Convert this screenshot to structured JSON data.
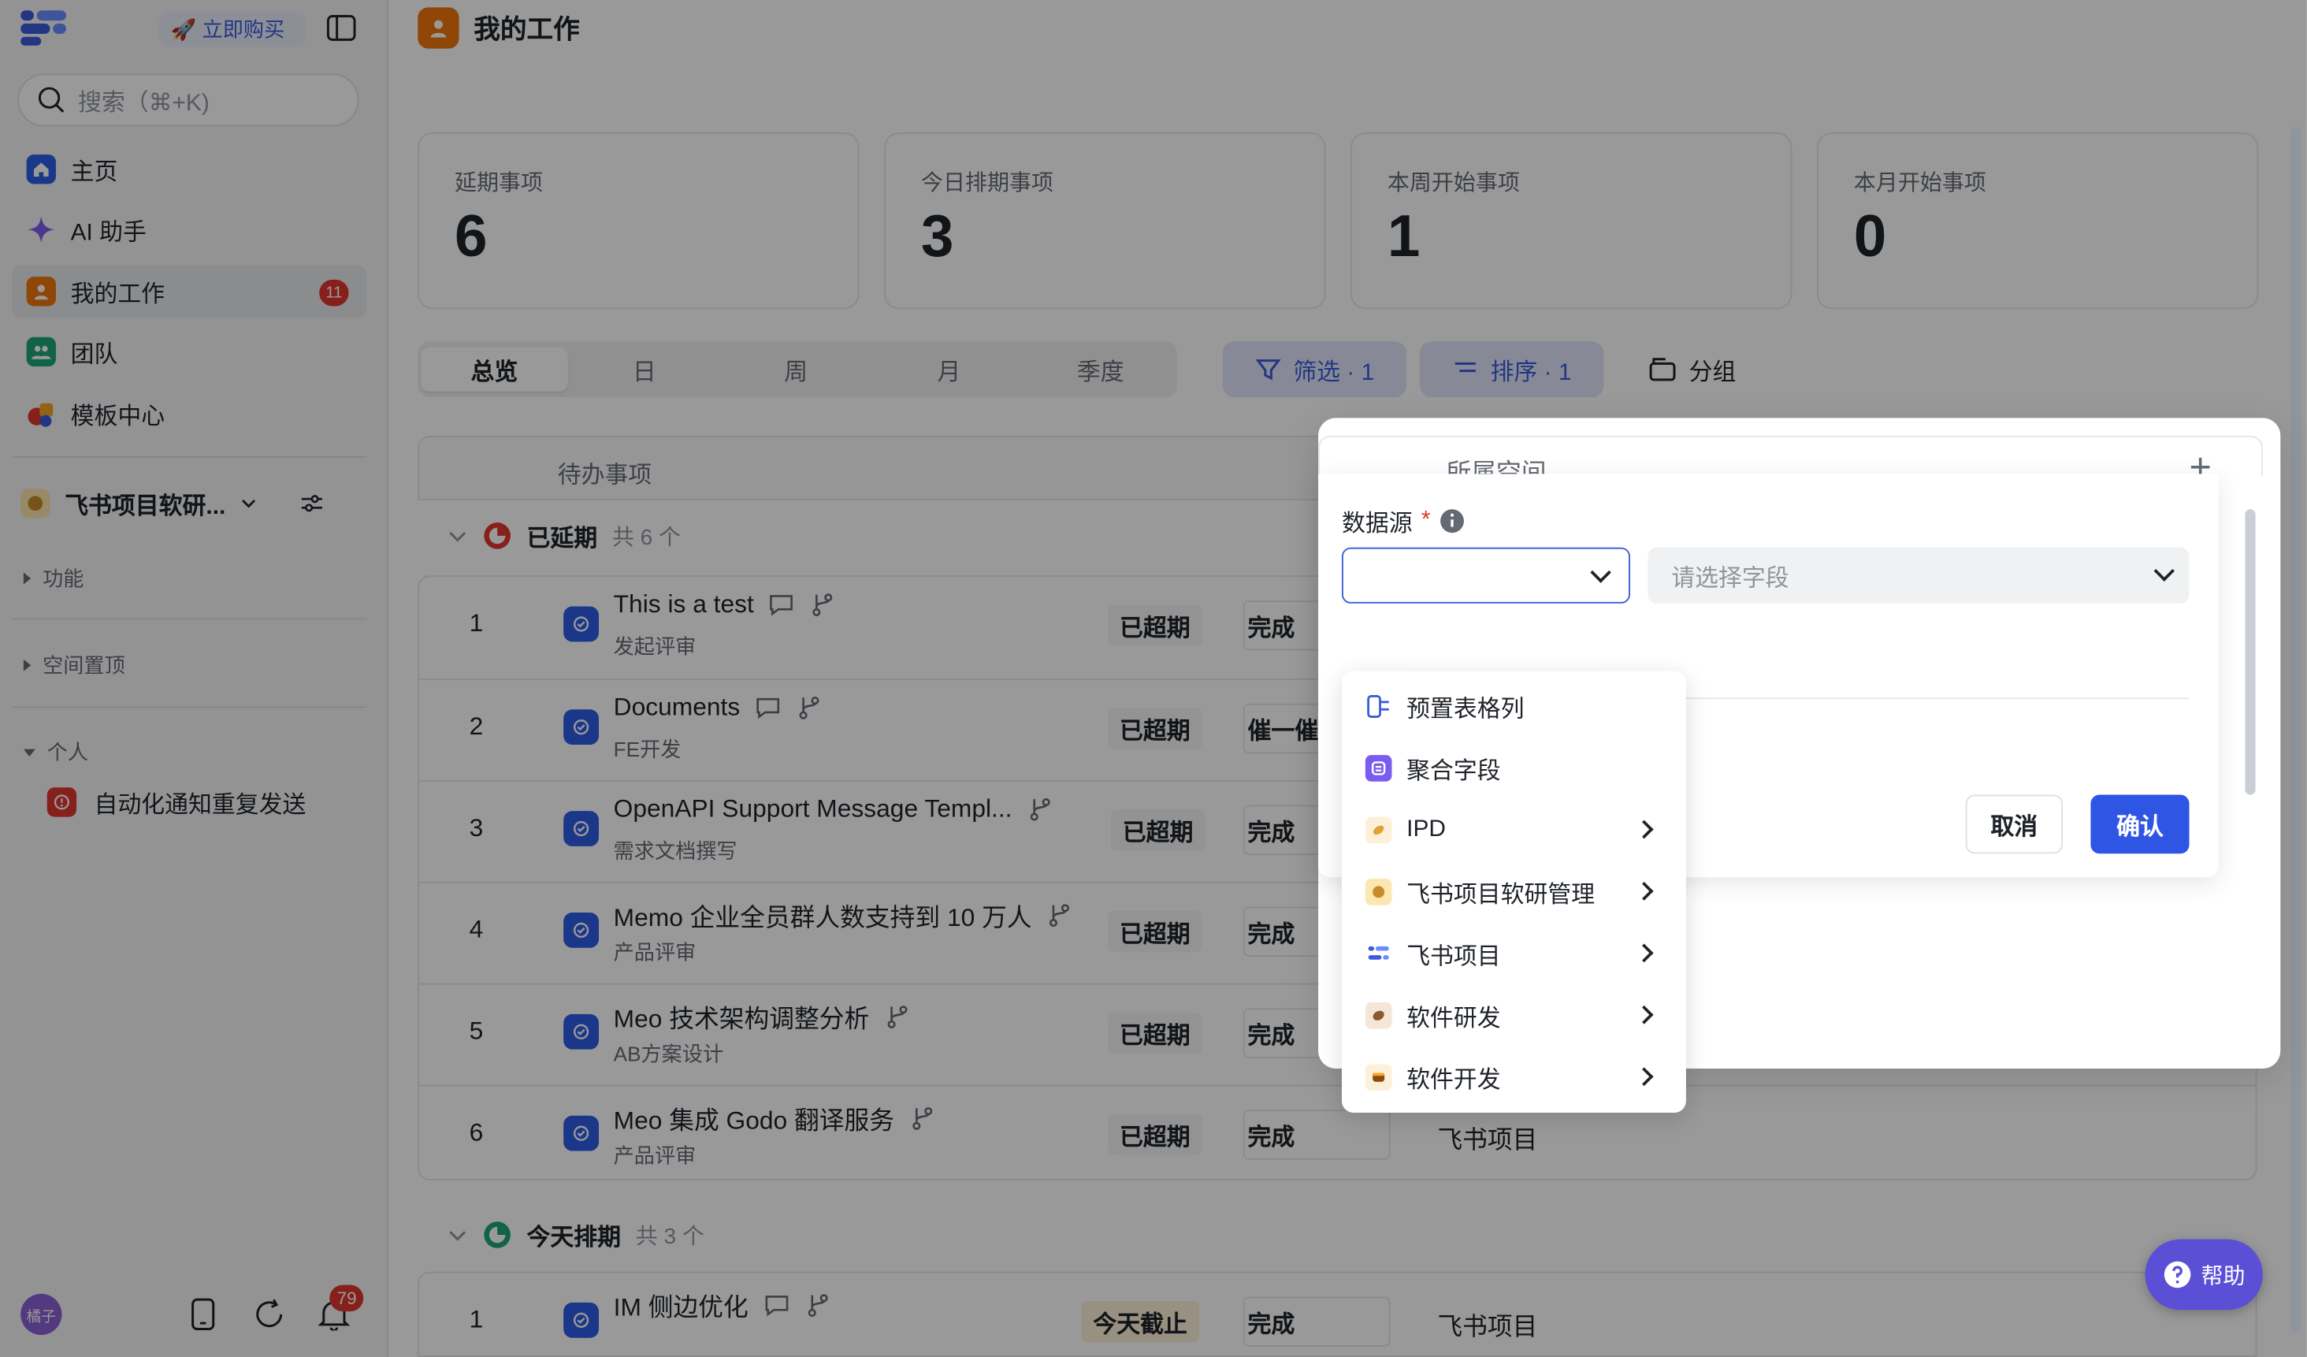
{
  "sidebar": {
    "buy_label": "立即购买",
    "search_placeholder": "搜索（⌘+K)",
    "nav": [
      {
        "label": "主页",
        "icon": "home-icon"
      },
      {
        "label": "AI 助手",
        "icon": "sparkle-icon"
      },
      {
        "label": "我的工作",
        "icon": "user-icon",
        "badge": "11"
      },
      {
        "label": "团队",
        "icon": "team-icon"
      },
      {
        "label": "模板中心",
        "icon": "template-icon"
      }
    ],
    "space_name": "飞书项目软研...",
    "sections": {
      "feature": "功能",
      "pinned": "空间置顶",
      "personal": "个人"
    },
    "automation_item": "自动化通知重复发送",
    "avatar_label": "橘子",
    "notification_count": "79"
  },
  "header": {
    "title": "我的工作"
  },
  "stats": [
    {
      "label": "延期事项",
      "value": "6"
    },
    {
      "label": "今日排期事项",
      "value": "3"
    },
    {
      "label": "本周开始事项",
      "value": "1"
    },
    {
      "label": "本月开始事项",
      "value": "0"
    }
  ],
  "tabs": [
    "总览",
    "日",
    "周",
    "月",
    "季度"
  ],
  "toolbar": {
    "filter": "筛选 · 1",
    "sort": "排序 · 1",
    "group": "分组"
  },
  "list": {
    "column_header": "待办事项",
    "group_overdue": {
      "title": "已延期",
      "count": "共 6 个"
    },
    "group_today": {
      "title": "今天排期",
      "count": "共 3 个"
    },
    "rows": [
      {
        "num": "1",
        "title": "This is a test",
        "sub": "发起评审",
        "tag": "已超期",
        "status": "完成",
        "space": ""
      },
      {
        "num": "2",
        "title": "Documents",
        "sub": "FE开发",
        "tag": "已超期",
        "status": "催一催",
        "space": ""
      },
      {
        "num": "3",
        "title": "OpenAPI Support Message Templ...",
        "sub": "需求文档撰写",
        "tag": "已超期",
        "status": "完成",
        "space": ""
      },
      {
        "num": "4",
        "title": "Memo 企业全员群人数支持到 10 万人",
        "sub": "产品评审",
        "tag": "已超期",
        "status": "完成",
        "space": ""
      },
      {
        "num": "5",
        "title": "Meo 技术架构调整分析",
        "sub": "AB方案设计",
        "tag": "已超期",
        "status": "完成",
        "space": ""
      },
      {
        "num": "6",
        "title": "Meo 集成 Godo 翻译服务",
        "sub": "产品评审",
        "tag": "已超期",
        "status": "完成",
        "space": "飞书项目"
      }
    ],
    "today_row": {
      "num": "1",
      "title": "IM 侧边优化",
      "tag": "今天截止",
      "status": "完成",
      "space": "飞书项目"
    }
  },
  "help_label": "帮助",
  "popup": {
    "header_label": "所属空间",
    "datasource_label": "数据源",
    "required_mark": "*",
    "field_placeholder": "请选择字段",
    "cancel": "取消",
    "confirm": "确认",
    "options": [
      {
        "label": "预置表格列",
        "icon": "table-column-icon",
        "has_sub": false
      },
      {
        "label": "聚合字段",
        "icon": "aggregate-icon",
        "has_sub": false
      },
      {
        "label": "IPD",
        "icon": "space-ipd-icon",
        "has_sub": true
      },
      {
        "label": "飞书项目软研管理",
        "icon": "space-rd-icon",
        "has_sub": true
      },
      {
        "label": "飞书项目",
        "icon": "space-project-icon",
        "has_sub": true
      },
      {
        "label": "软件研发",
        "icon": "space-software-icon",
        "has_sub": true
      },
      {
        "label": "软件开发",
        "icon": "space-dev-icon",
        "has_sub": true
      }
    ]
  },
  "colors": {
    "accent": "#2f55e4",
    "overdue_red": "#e0362e",
    "today_green": "#1fa37a"
  }
}
